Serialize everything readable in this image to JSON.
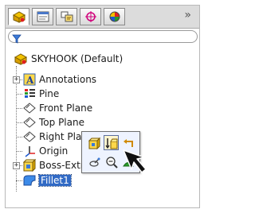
{
  "panel": {
    "tabs": [
      {
        "icon": "featuremanager-icon",
        "active": true
      },
      {
        "icon": "propertymanager-icon",
        "active": false
      },
      {
        "icon": "configurationmanager-icon",
        "active": false
      },
      {
        "icon": "dimxpertmanager-icon",
        "active": false
      },
      {
        "icon": "displaymanager-icon",
        "active": false
      }
    ],
    "more_tabs": "»"
  },
  "filter": {
    "icon": "filter-icon"
  },
  "tree": {
    "root": {
      "label": "SKYHOOK  (Default)",
      "icon": "part-icon"
    },
    "items": [
      {
        "label": "Annotations",
        "icon": "annotations-icon",
        "expandable": true
      },
      {
        "label": "Pine",
        "icon": "material-icon",
        "expandable": false
      },
      {
        "label": "Front Plane",
        "icon": "plane-icon",
        "expandable": false
      },
      {
        "label": "Top Plane",
        "icon": "plane-icon",
        "expandable": false
      },
      {
        "label": "Right Plane",
        "icon": "plane-icon",
        "expandable": false
      },
      {
        "label": "Origin",
        "icon": "origin-icon",
        "expandable": false
      },
      {
        "label": "Boss-Extrude1",
        "icon": "extrude-icon",
        "expandable": true
      },
      {
        "label": "Fillet1",
        "icon": "fillet-icon",
        "expandable": false,
        "selected": true
      }
    ]
  },
  "context_toolbar": {
    "buttons": [
      {
        "icon": "edit-feature-icon"
      },
      {
        "icon": "edit-sketch-icon"
      },
      {
        "icon": "rollback-icon"
      },
      {
        "icon": "appearance-icon"
      },
      {
        "icon": "zoom-to-selection-icon"
      },
      {
        "icon": "hide-icon"
      }
    ]
  },
  "colors": {
    "selection": "#316ac5",
    "popup_bg": "#eef3ff"
  }
}
